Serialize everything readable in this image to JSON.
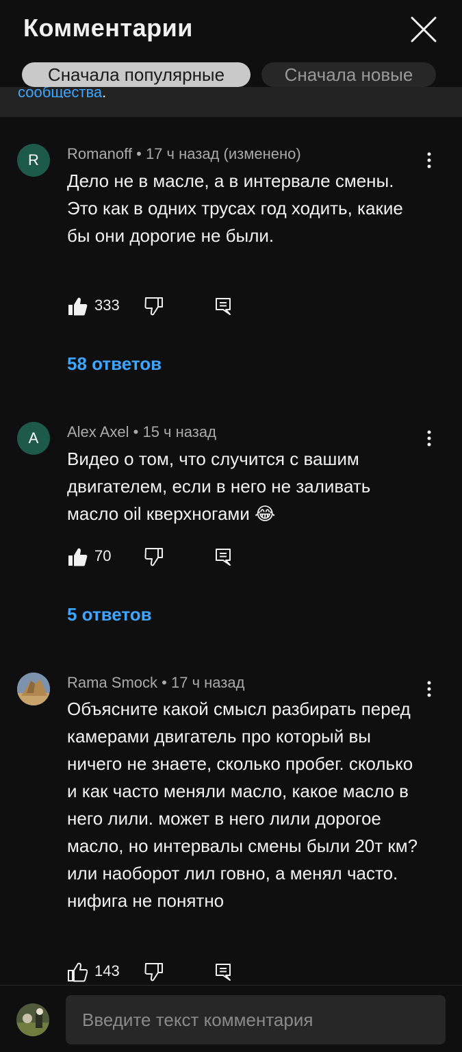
{
  "header": {
    "title": "Комментарии",
    "close_icon": "close-icon"
  },
  "sort": {
    "popular": "Сначала популярные",
    "new": "Сначала новые"
  },
  "banner": {
    "link_text": "сообщества",
    "suffix": "."
  },
  "comments": [
    {
      "avatar_letter": "R",
      "avatar_color": "#1e5a4a",
      "author": "Romanoff",
      "time": "17 ч назад (изменено)",
      "text": "Дело не в масле, а в интервале смены.  Это как в одних трусах год ходить, какие бы они дорогие не были.",
      "likes": "333",
      "replies": "58 ответов"
    },
    {
      "avatar_letter": "A",
      "avatar_color": "#1e5a4a",
      "author": "Alex Axel",
      "time": "15 ч назад",
      "text": "Видео о том, что случится с вашим двигателем, если в него не заливать масло oil кверхногами 😂",
      "likes": "70",
      "replies": "5 ответов"
    },
    {
      "avatar_letter": "",
      "avatar_color": "#6f87a3",
      "author": "Rama Smock",
      "time": "17 ч назад",
      "text": "Объясните какой смысл разбирать перед камерами двигатель про который вы ничего не знаете, сколько пробег. сколько и как часто меняли масло, какое масло в него лили. может в него лили дорогое масло, но интервалы смены были 20т км? или наоборот лил говно, а менял часто. нифига не понятно",
      "likes": "143"
    }
  ],
  "composer": {
    "placeholder": "Введите текст комментария"
  },
  "colors": {
    "background": "#0f0f0f",
    "accent_link": "#3ea6ff",
    "meta_text": "#aaaaaa",
    "chip_active_bg": "#c9c9c9",
    "chip_inactive_bg": "#272727"
  }
}
